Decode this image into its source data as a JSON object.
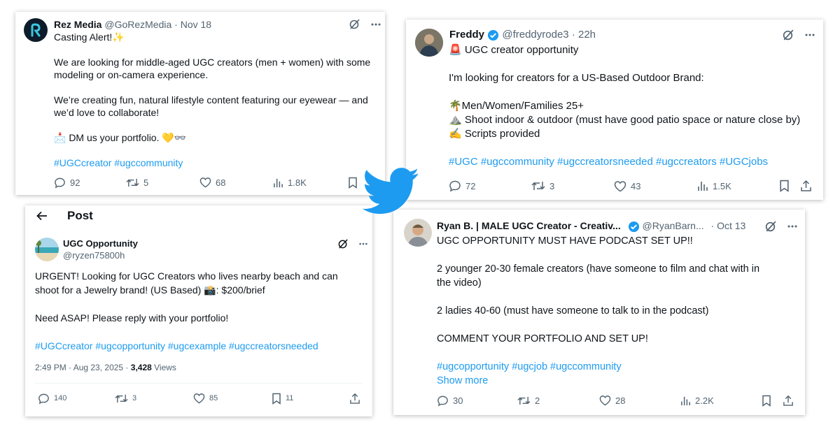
{
  "colors": {
    "accent": "#1d9bf0",
    "muted": "#536471",
    "text": "#0f1419",
    "heart": "#f5c542"
  },
  "card1": {
    "name": "Rez Media",
    "handle": "@GoRezMedia",
    "sep": "·",
    "date": "Nov 18",
    "lines": [
      "Casting Alert!✨",
      "",
      "We are looking for middle-aged UGC creators (men + women) with some",
      "modeling or on-camera experience.",
      "",
      "We’re creating fun, natural lifestyle content featuring our eyewear — and",
      "we’d love to collaborate!",
      "",
      "📩 DM us your portfolio. 💛👓",
      "",
      "#UGCcreator #ugccommunity"
    ],
    "replies": "92",
    "reposts": "5",
    "likes": "68",
    "views": "1.8K"
  },
  "card2": {
    "name": "Freddy",
    "handle": "@freddyrode3",
    "sep": "·",
    "date": "22h",
    "lines": [
      "🚨 UGC creator opportunity",
      "",
      "I'm looking for creators for a US-Based Outdoor Brand:",
      "",
      "🌴Men/Women/Families 25+",
      "⛰️ Shoot indoor & outdoor (must have good patio space or nature close by)",
      "✍️ Scripts provided",
      "",
      "#UGC #ugccommunity #ugccreatorsneeded #ugccreators #UGCjobs"
    ],
    "replies": "72",
    "reposts": "3",
    "likes": "43",
    "views": "1.5K"
  },
  "card3": {
    "header_title": "Post",
    "name": "UGC Opportunity",
    "handle": "@ryzen75800h",
    "lines": [
      "URGENT! Looking for UGC Creators who lives nearby beach and can",
      "shoot for a Jewelry brand! (US Based)  📸: $200/brief",
      "",
      "Need ASAP! Please reply with your portfolio!",
      "",
      "#UGCcreator #ugcopportunity #ugcexample #ugccreatorsneeded"
    ],
    "timestamp": "2:49 PM · Aug 23, 2025 · ",
    "views_count": "3,428",
    "views_label": " Views",
    "replies": "140",
    "reposts": "3",
    "likes": "85",
    "bookmarks": "11"
  },
  "card4": {
    "name": "Ryan B. | MALE UGC Creator - Creativ...",
    "handle": "@RyanBarn...",
    "sep": "·",
    "date": "Oct 13",
    "lines": [
      "UGC OPPORTUNITY MUST HAVE PODCAST SET UP!!",
      "",
      "2 younger 20-30 female creators (have someone to film and chat with in",
      "the video)",
      "",
      "2 ladies 40-60 (must have someone to talk to in the podcast)",
      "",
      "COMMENT YOUR PORTFOLIO AND SET UP!",
      "",
      "#ugcopportunity #ugcjob #ugccommunity"
    ],
    "show_more": "Show more",
    "replies": "30",
    "reposts": "2",
    "likes": "28",
    "views": "2.2K"
  }
}
